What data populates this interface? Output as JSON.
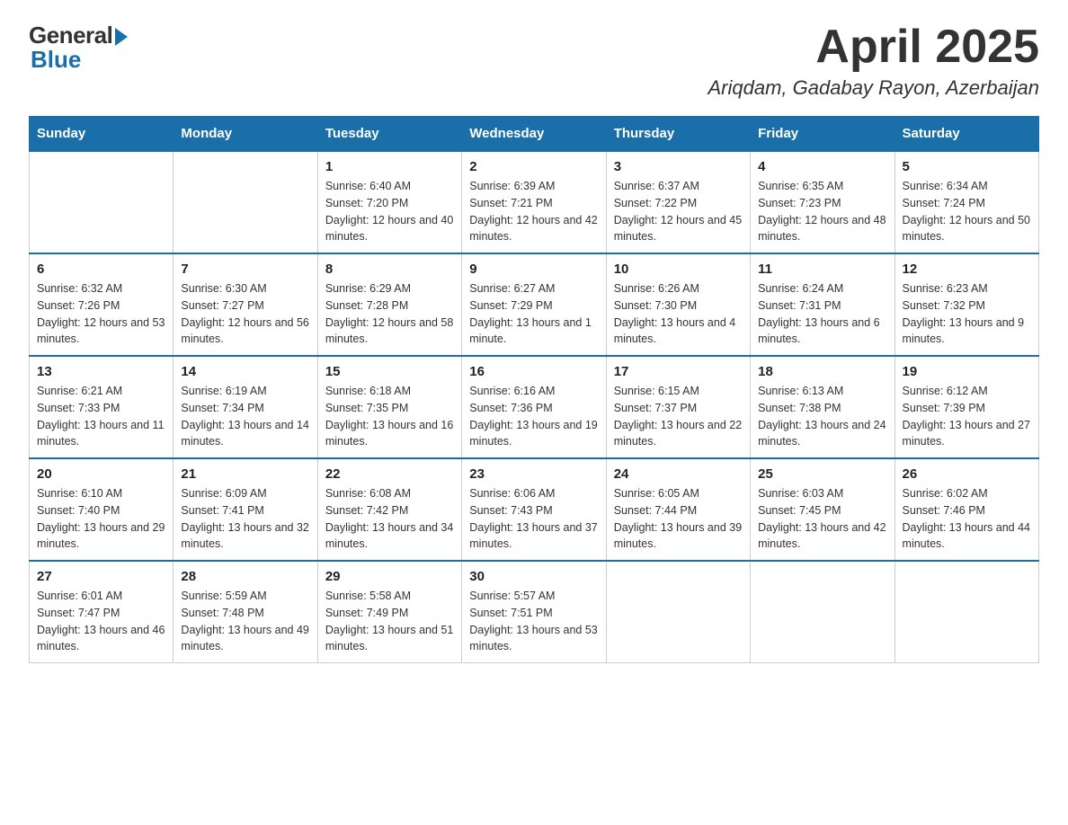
{
  "header": {
    "logo": {
      "general": "General",
      "blue": "Blue"
    },
    "title": "April 2025",
    "location": "Ariqdam, Gadabay Rayon, Azerbaijan"
  },
  "days_header": [
    "Sunday",
    "Monday",
    "Tuesday",
    "Wednesday",
    "Thursday",
    "Friday",
    "Saturday"
  ],
  "weeks": [
    [
      {
        "day": "",
        "sunrise": "",
        "sunset": "",
        "daylight": ""
      },
      {
        "day": "",
        "sunrise": "",
        "sunset": "",
        "daylight": ""
      },
      {
        "day": "1",
        "sunrise": "Sunrise: 6:40 AM",
        "sunset": "Sunset: 7:20 PM",
        "daylight": "Daylight: 12 hours and 40 minutes."
      },
      {
        "day": "2",
        "sunrise": "Sunrise: 6:39 AM",
        "sunset": "Sunset: 7:21 PM",
        "daylight": "Daylight: 12 hours and 42 minutes."
      },
      {
        "day": "3",
        "sunrise": "Sunrise: 6:37 AM",
        "sunset": "Sunset: 7:22 PM",
        "daylight": "Daylight: 12 hours and 45 minutes."
      },
      {
        "day": "4",
        "sunrise": "Sunrise: 6:35 AM",
        "sunset": "Sunset: 7:23 PM",
        "daylight": "Daylight: 12 hours and 48 minutes."
      },
      {
        "day": "5",
        "sunrise": "Sunrise: 6:34 AM",
        "sunset": "Sunset: 7:24 PM",
        "daylight": "Daylight: 12 hours and 50 minutes."
      }
    ],
    [
      {
        "day": "6",
        "sunrise": "Sunrise: 6:32 AM",
        "sunset": "Sunset: 7:26 PM",
        "daylight": "Daylight: 12 hours and 53 minutes."
      },
      {
        "day": "7",
        "sunrise": "Sunrise: 6:30 AM",
        "sunset": "Sunset: 7:27 PM",
        "daylight": "Daylight: 12 hours and 56 minutes."
      },
      {
        "day": "8",
        "sunrise": "Sunrise: 6:29 AM",
        "sunset": "Sunset: 7:28 PM",
        "daylight": "Daylight: 12 hours and 58 minutes."
      },
      {
        "day": "9",
        "sunrise": "Sunrise: 6:27 AM",
        "sunset": "Sunset: 7:29 PM",
        "daylight": "Daylight: 13 hours and 1 minute."
      },
      {
        "day": "10",
        "sunrise": "Sunrise: 6:26 AM",
        "sunset": "Sunset: 7:30 PM",
        "daylight": "Daylight: 13 hours and 4 minutes."
      },
      {
        "day": "11",
        "sunrise": "Sunrise: 6:24 AM",
        "sunset": "Sunset: 7:31 PM",
        "daylight": "Daylight: 13 hours and 6 minutes."
      },
      {
        "day": "12",
        "sunrise": "Sunrise: 6:23 AM",
        "sunset": "Sunset: 7:32 PM",
        "daylight": "Daylight: 13 hours and 9 minutes."
      }
    ],
    [
      {
        "day": "13",
        "sunrise": "Sunrise: 6:21 AM",
        "sunset": "Sunset: 7:33 PM",
        "daylight": "Daylight: 13 hours and 11 minutes."
      },
      {
        "day": "14",
        "sunrise": "Sunrise: 6:19 AM",
        "sunset": "Sunset: 7:34 PM",
        "daylight": "Daylight: 13 hours and 14 minutes."
      },
      {
        "day": "15",
        "sunrise": "Sunrise: 6:18 AM",
        "sunset": "Sunset: 7:35 PM",
        "daylight": "Daylight: 13 hours and 16 minutes."
      },
      {
        "day": "16",
        "sunrise": "Sunrise: 6:16 AM",
        "sunset": "Sunset: 7:36 PM",
        "daylight": "Daylight: 13 hours and 19 minutes."
      },
      {
        "day": "17",
        "sunrise": "Sunrise: 6:15 AM",
        "sunset": "Sunset: 7:37 PM",
        "daylight": "Daylight: 13 hours and 22 minutes."
      },
      {
        "day": "18",
        "sunrise": "Sunrise: 6:13 AM",
        "sunset": "Sunset: 7:38 PM",
        "daylight": "Daylight: 13 hours and 24 minutes."
      },
      {
        "day": "19",
        "sunrise": "Sunrise: 6:12 AM",
        "sunset": "Sunset: 7:39 PM",
        "daylight": "Daylight: 13 hours and 27 minutes."
      }
    ],
    [
      {
        "day": "20",
        "sunrise": "Sunrise: 6:10 AM",
        "sunset": "Sunset: 7:40 PM",
        "daylight": "Daylight: 13 hours and 29 minutes."
      },
      {
        "day": "21",
        "sunrise": "Sunrise: 6:09 AM",
        "sunset": "Sunset: 7:41 PM",
        "daylight": "Daylight: 13 hours and 32 minutes."
      },
      {
        "day": "22",
        "sunrise": "Sunrise: 6:08 AM",
        "sunset": "Sunset: 7:42 PM",
        "daylight": "Daylight: 13 hours and 34 minutes."
      },
      {
        "day": "23",
        "sunrise": "Sunrise: 6:06 AM",
        "sunset": "Sunset: 7:43 PM",
        "daylight": "Daylight: 13 hours and 37 minutes."
      },
      {
        "day": "24",
        "sunrise": "Sunrise: 6:05 AM",
        "sunset": "Sunset: 7:44 PM",
        "daylight": "Daylight: 13 hours and 39 minutes."
      },
      {
        "day": "25",
        "sunrise": "Sunrise: 6:03 AM",
        "sunset": "Sunset: 7:45 PM",
        "daylight": "Daylight: 13 hours and 42 minutes."
      },
      {
        "day": "26",
        "sunrise": "Sunrise: 6:02 AM",
        "sunset": "Sunset: 7:46 PM",
        "daylight": "Daylight: 13 hours and 44 minutes."
      }
    ],
    [
      {
        "day": "27",
        "sunrise": "Sunrise: 6:01 AM",
        "sunset": "Sunset: 7:47 PM",
        "daylight": "Daylight: 13 hours and 46 minutes."
      },
      {
        "day": "28",
        "sunrise": "Sunrise: 5:59 AM",
        "sunset": "Sunset: 7:48 PM",
        "daylight": "Daylight: 13 hours and 49 minutes."
      },
      {
        "day": "29",
        "sunrise": "Sunrise: 5:58 AM",
        "sunset": "Sunset: 7:49 PM",
        "daylight": "Daylight: 13 hours and 51 minutes."
      },
      {
        "day": "30",
        "sunrise": "Sunrise: 5:57 AM",
        "sunset": "Sunset: 7:51 PM",
        "daylight": "Daylight: 13 hours and 53 minutes."
      },
      {
        "day": "",
        "sunrise": "",
        "sunset": "",
        "daylight": ""
      },
      {
        "day": "",
        "sunrise": "",
        "sunset": "",
        "daylight": ""
      },
      {
        "day": "",
        "sunrise": "",
        "sunset": "",
        "daylight": ""
      }
    ]
  ]
}
